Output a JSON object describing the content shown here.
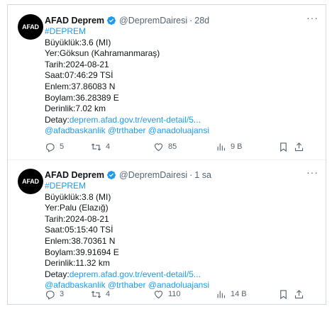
{
  "tweets": [
    {
      "avatar_text": "AFAD",
      "name": "AFAD Deprem",
      "handle": "@DepremDairesi",
      "separator": "·",
      "time": "28d",
      "hashtag": "#DEPREM",
      "lines": [
        "Büyüklük:3.6 (MI)",
        "Yer:Göksun (Kahramanmaraş)",
        "Tarih:2024-08-21",
        "Saat:07:46:29 TSİ",
        "Enlem:37.86083 N",
        "Boylam:36.28389 E",
        "Derinlik:7.02 km"
      ],
      "detail_label": "Detay:",
      "detail_link": "deprem.afad.gov.tr/event-detail/5...",
      "mentions": "@afadbaskanlik @trthaber @anadoluajansi",
      "replies": "5",
      "retweets": "4",
      "likes": "85",
      "views": "9 B"
    },
    {
      "avatar_text": "AFAD",
      "name": "AFAD Deprem",
      "handle": "@DepremDairesi",
      "separator": "·",
      "time": "1 sa",
      "hashtag": "#DEPREM",
      "lines": [
        "Büyüklük:3.8 (MI)",
        "Yer:Palu (Elazığ)",
        "Tarih:2024-08-21",
        "Saat:05:15:40 TSİ",
        "Enlem:38.70361 N",
        "Boylam:39.91694 E",
        "Derinlik:11.32 km"
      ],
      "detail_label": "Detay:",
      "detail_link": "deprem.afad.gov.tr/event-detail/5...",
      "mentions": "@afadbaskanlik @trthaber @anadoluajansi",
      "replies": "3",
      "retweets": "4",
      "likes": "110",
      "views": "14 B"
    }
  ],
  "icons": {
    "more": "more-horizontal-icon",
    "reply": "reply-icon",
    "retweet": "retweet-icon",
    "like": "heart-icon",
    "views": "views-chart-icon",
    "bookmark": "bookmark-icon",
    "share": "share-icon",
    "verified": "verified-badge-icon"
  },
  "colors": {
    "link": "#1d9bf0",
    "text": "#0f1419",
    "muted": "#536471",
    "border": "#cfd9de"
  }
}
